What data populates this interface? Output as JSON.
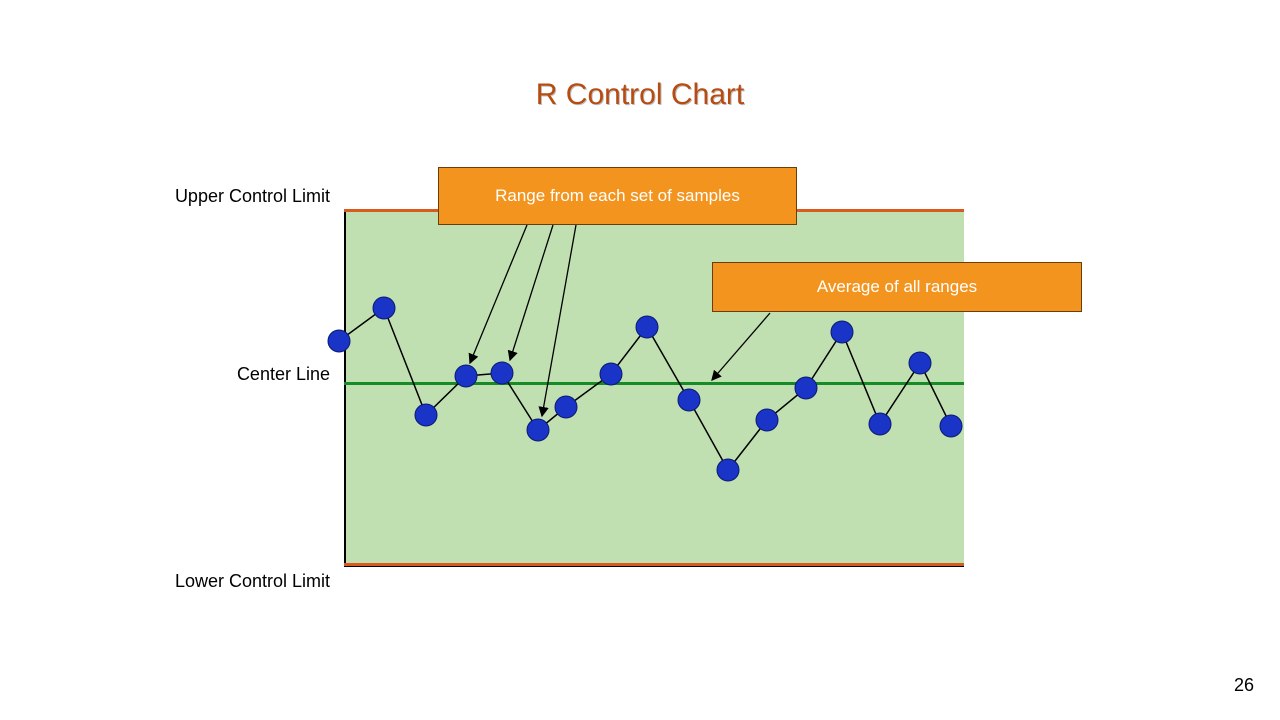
{
  "title": "R Control Chart",
  "labels": {
    "ucl": "Upper Control Limit",
    "center": "Center Line",
    "lcl": "Lower Control Limit"
  },
  "callouts": {
    "range": "Range from each set of samples",
    "average": "Average of all ranges"
  },
  "page_number": "26",
  "chart_data": {
    "type": "line",
    "title": "R Control Chart",
    "xlabel": "",
    "ylabel": "",
    "ylim": [
      0,
      100
    ],
    "ucl": 100,
    "center_line": 51,
    "lcl": 0,
    "x": [
      1,
      2,
      3,
      4,
      5,
      6,
      7,
      8,
      9,
      10,
      11,
      12,
      13,
      14,
      15,
      16
    ],
    "values": [
      63,
      78,
      42,
      53,
      55,
      38,
      45,
      54,
      71,
      46,
      27,
      40,
      50,
      68,
      41,
      57,
      39
    ],
    "annotations": [
      {
        "text": "Range from each set of samples",
        "target_points": [
          4,
          5,
          6
        ]
      },
      {
        "text": "Average of all ranges",
        "target": "center_line"
      }
    ]
  }
}
